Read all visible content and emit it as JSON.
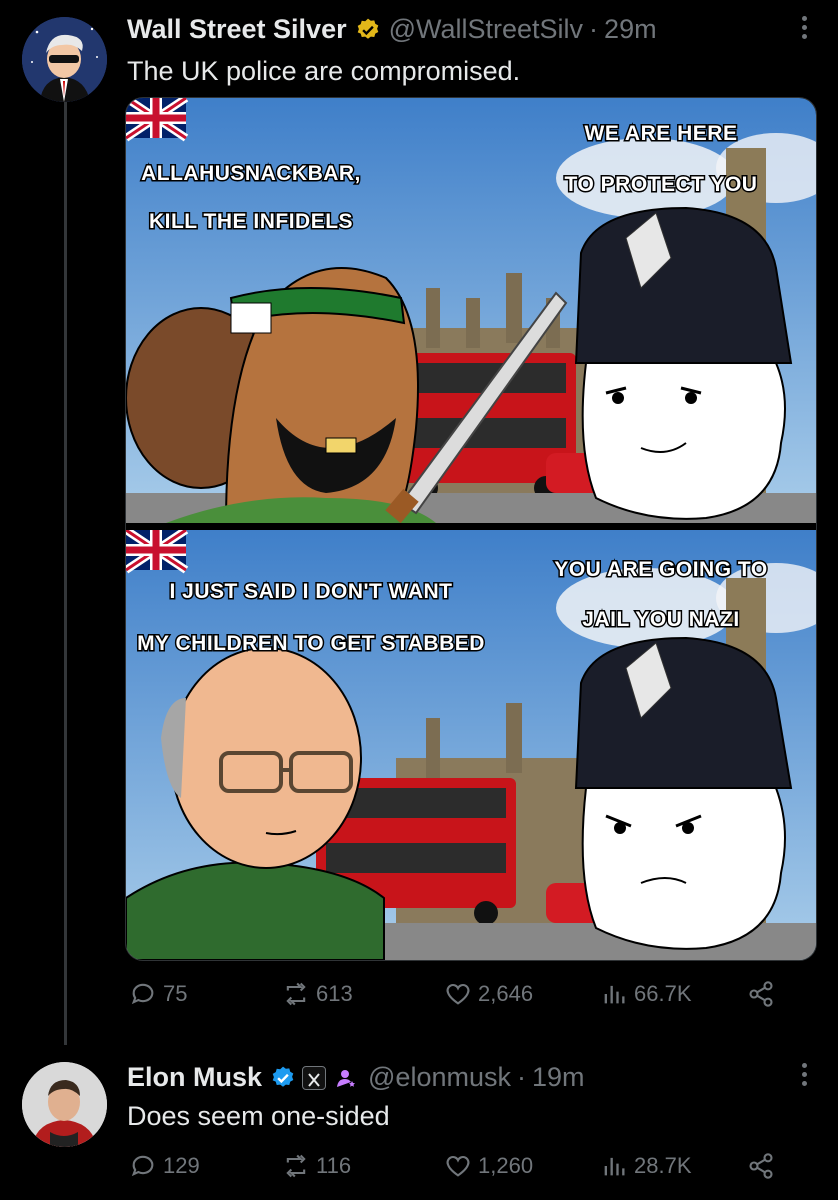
{
  "tweet": {
    "author_name": "Wall Street Silver",
    "handle": "@WallStreetSilv",
    "separator": "·",
    "time": "29m",
    "text": "The UK police are compromised.",
    "verified": true,
    "meme": {
      "panel1_left": [
        "ALLAHUSNACKBAR,",
        "KILL THE INFIDELS"
      ],
      "panel1_right": [
        "WE ARE HERE",
        "TO PROTECT YOU"
      ],
      "panel2_left": [
        "I JUST SAID I DON'T WANT",
        "MY CHILDREN TO GET STABBED"
      ],
      "panel2_right": [
        "YOU ARE GOING TO",
        "JAIL YOU NAZI"
      ]
    },
    "stats": {
      "replies": "75",
      "reposts": "613",
      "likes": "2,646",
      "views": "66.7K"
    }
  },
  "reply": {
    "author_name": "Elon Musk",
    "handle": "@elonmusk",
    "separator": "·",
    "time": "19m",
    "text": "Does seem one-sided",
    "verified": true,
    "stats": {
      "replies": "129",
      "reposts": "116",
      "likes": "1,260",
      "views": "28.7K"
    }
  },
  "colors": {
    "verified_gold": "#e2b719",
    "verified_blue": "#1d9bf0",
    "muted": "#71767b",
    "background": "#000000"
  },
  "icons": [
    "reply-icon",
    "repost-icon",
    "like-icon",
    "views-icon",
    "share-icon",
    "more-icon",
    "verified-badge-icon",
    "x-affiliate-icon",
    "subscriber-icon"
  ]
}
